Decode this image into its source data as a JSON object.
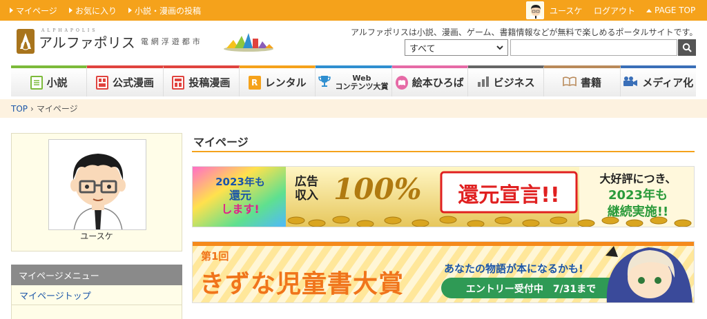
{
  "topbar": {
    "links": [
      "マイページ",
      "お気に入り",
      "小説・漫画の投稿"
    ],
    "user_name": "ユースケ",
    "logout": "ログアウト",
    "page_top": "PAGE TOP"
  },
  "header": {
    "logo_sub": "ALPHAPOLIS",
    "logo_text": "アルファポリス",
    "logo_tag": "電網浮遊都市",
    "tagline": "アルファポリスは小説、漫画、ゲーム、書籍情報などが無料で楽しめるポータルサイトです。",
    "search_select": "すべて",
    "search_placeholder": ""
  },
  "nav": {
    "items": [
      {
        "label": "小説",
        "icon": "book-icon",
        "color": "#7cba3a"
      },
      {
        "label": "公式漫画",
        "icon": "comic-icon",
        "color": "#e0433e"
      },
      {
        "label": "投稿漫画",
        "icon": "comic-post-icon",
        "color": "#e0433e"
      },
      {
        "label": "レンタル",
        "icon": "rental-icon",
        "color": "#f5a21b"
      },
      {
        "label": "Web",
        "label2": "コンテンツ大賞",
        "icon": "trophy-icon",
        "color": "#2f8fd0"
      },
      {
        "label": "絵本ひろば",
        "icon": "picture-book-icon",
        "color": "#e66aa6"
      },
      {
        "label": "ビジネス",
        "icon": "chart-icon",
        "color": "#666666"
      },
      {
        "label": "書籍",
        "icon": "open-book-icon",
        "color": "#b98a5a"
      },
      {
        "label": "メディア化",
        "icon": "camera-icon",
        "color": "#3a6fb8"
      }
    ]
  },
  "breadcrumb": {
    "home": "TOP",
    "sep": "›",
    "current": "マイページ"
  },
  "profile": {
    "name": "ユースケ"
  },
  "sidebar": {
    "menu_title": "マイページメニュー",
    "items": [
      "マイページトップ"
    ]
  },
  "main": {
    "title": "マイページ"
  },
  "banner1": {
    "left1": "2023年も",
    "left2": "還元",
    "left3": "します!",
    "mid_small1": "広告",
    "mid_small2": "収入",
    "percent": "100%",
    "headline": "還元宣言!!",
    "right1": "大好評につき、",
    "right2": "2023年も",
    "right3": "継続実施!!"
  },
  "banner2": {
    "edition": "第1回",
    "title": "きずな児童書大賞",
    "sub": "あなたの物語が本になるかも!",
    "entry": "エントリー受付中　7/31まで"
  }
}
